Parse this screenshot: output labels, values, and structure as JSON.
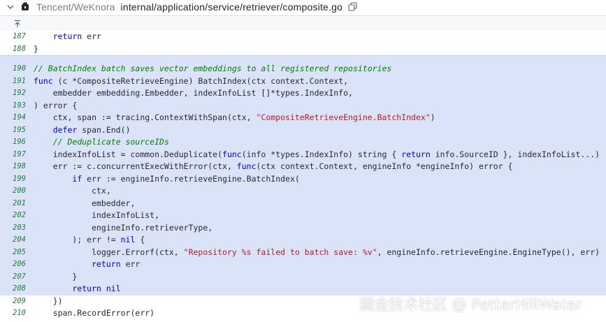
{
  "header": {
    "repo": "Tencent/WeKnora",
    "file_path": "internal/application/service/retriever/composite.go",
    "icons": {
      "collapse": "chevron-down-icon",
      "repo": "repo-icon",
      "copy": "copy-icon",
      "expand": "expand-up-icon"
    }
  },
  "colors": {
    "selection_bg": "#dbe3f8",
    "line_number": "#1a7f37",
    "keyword": "#0000cc",
    "string": "#b31d28",
    "comment": "#008000"
  },
  "code_lines": [
    {
      "num": "187",
      "text": "    return err",
      "selected": false
    },
    {
      "num": "188",
      "text": "}",
      "selected": false
    },
    {
      "num": "190",
      "text": "// BatchIndex batch saves vector embeddings to all registered repositories",
      "selected": true
    },
    {
      "num": "191",
      "text": "func (c *CompositeRetrieveEngine) BatchIndex(ctx context.Context,",
      "selected": true
    },
    {
      "num": "192",
      "text": "    embedder embedding.Embedder, indexInfoList []*types.IndexInfo,",
      "selected": true
    },
    {
      "num": "193",
      "text": ") error {",
      "selected": true
    },
    {
      "num": "194",
      "text": "    ctx, span := tracing.ContextWithSpan(ctx, \"CompositeRetrieveEngine.BatchIndex\")",
      "selected": true
    },
    {
      "num": "195",
      "text": "    defer span.End()",
      "selected": true
    },
    {
      "num": "196",
      "text": "    // Deduplicate sourceIDs",
      "selected": true
    },
    {
      "num": "197",
      "text": "    indexInfoList = common.Deduplicate(func(info *types.IndexInfo) string { return info.SourceID }, indexInfoList...)",
      "selected": true
    },
    {
      "num": "198",
      "text": "    err := c.concurrentExecWithError(ctx, func(ctx context.Context, engineInfo *engineInfo) error {",
      "selected": true
    },
    {
      "num": "199",
      "text": "        if err := engineInfo.retrieveEngine.BatchIndex(",
      "selected": true
    },
    {
      "num": "200",
      "text": "            ctx,",
      "selected": true
    },
    {
      "num": "201",
      "text": "            embedder,",
      "selected": true
    },
    {
      "num": "202",
      "text": "            indexInfoList,",
      "selected": true
    },
    {
      "num": "203",
      "text": "            engineInfo.retrieverType,",
      "selected": true
    },
    {
      "num": "204",
      "text": "        ); err != nil {",
      "selected": true
    },
    {
      "num": "205",
      "text": "            logger.Errorf(ctx, \"Repository %s failed to batch save: %v\", engineInfo.retrieveEngine.EngineType(), err)",
      "selected": true
    },
    {
      "num": "206",
      "text": "            return err",
      "selected": true
    },
    {
      "num": "207",
      "text": "        }",
      "selected": true
    },
    {
      "num": "208",
      "text": "        return nil",
      "selected": true
    },
    {
      "num": "209",
      "text": "    })",
      "selected": false
    },
    {
      "num": "210",
      "text": "    span.RecordError(err)",
      "selected": false
    }
  ],
  "watermark": "掘金技术社区 @ PetterHillWater"
}
